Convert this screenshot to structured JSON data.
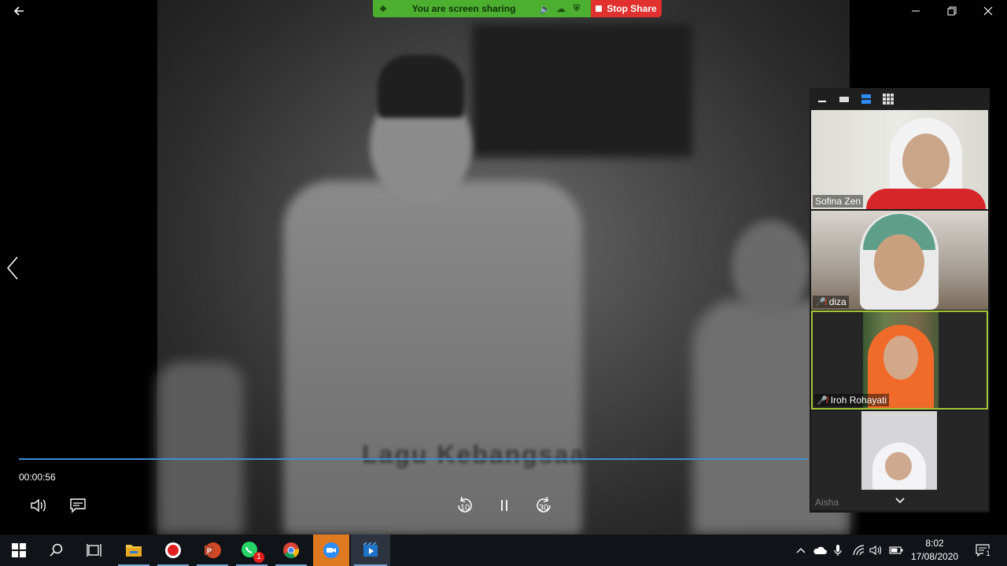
{
  "share_bar": {
    "status_text": "You are screen sharing",
    "stop_label": "Stop Share",
    "green_color": "#4caf2f",
    "stop_color": "#e0312f"
  },
  "video": {
    "caption_text": "Lagu Kebangsaan RI"
  },
  "player": {
    "elapsed_time": "00:00:56",
    "rewind_seconds": "10",
    "forward_seconds": "30",
    "progress_color": "#3c8fd8"
  },
  "gallery": {
    "participants": [
      {
        "name": "Sofina Zen",
        "muted": false
      },
      {
        "name": "diza",
        "muted": true
      },
      {
        "name": "Iroh Rohayati",
        "muted": true,
        "active_speaker": true
      },
      {
        "name": "Aisha",
        "muted": false
      }
    ],
    "active_border_color": "#a4c639"
  },
  "taskbar": {
    "whatsapp_badge": "1",
    "clock_time": "8:02",
    "clock_date": "17/08/2020",
    "notification_count": "1"
  }
}
